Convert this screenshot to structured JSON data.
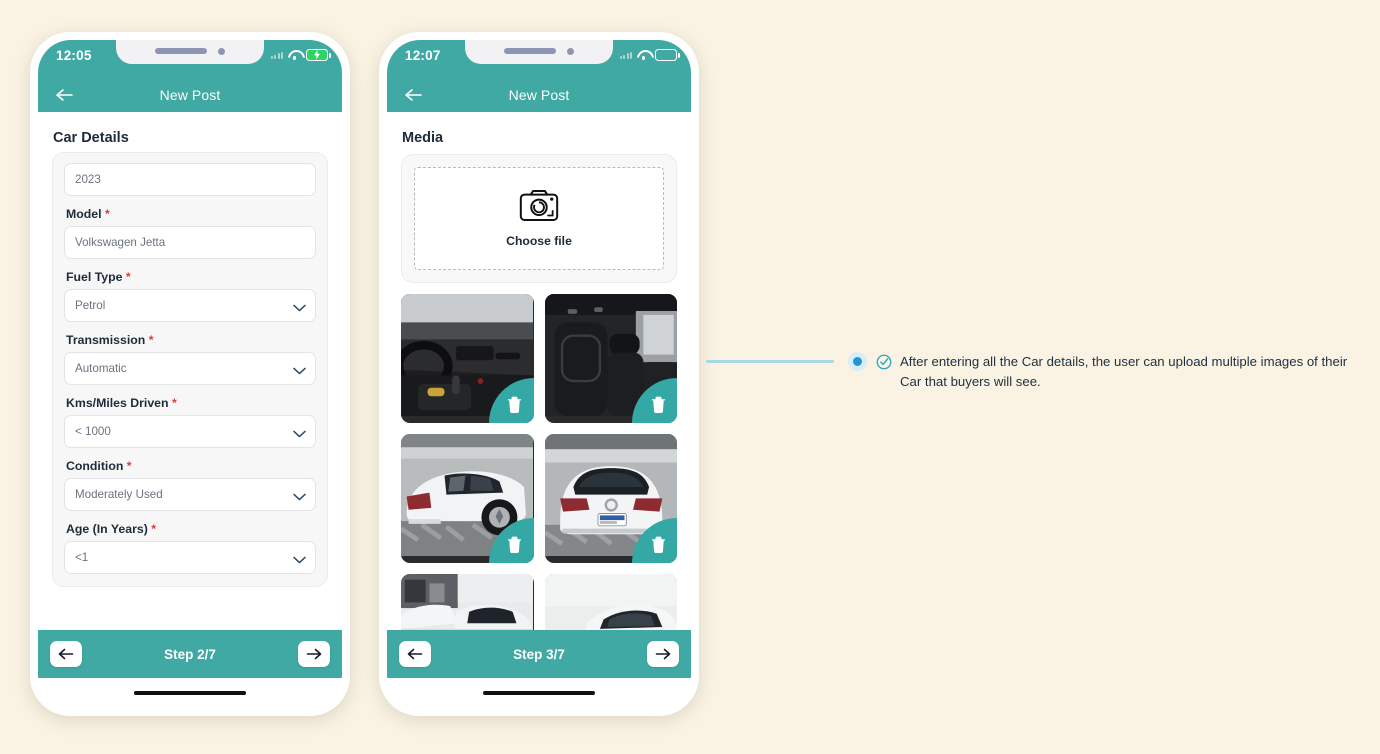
{
  "background_color": "#faf3e3",
  "accent_color": "#41a9a3",
  "required_color": "#e03b3b",
  "phones": [
    {
      "id": "phone-car-details",
      "status_bar": {
        "time": "12:05",
        "battery_state": "charging",
        "wifi_icon": "wifi-icon",
        "signal_icon": "signal-icon",
        "battery_icon": "battery-charging-icon"
      },
      "app_bar": {
        "title": "New Post",
        "back_icon": "back-arrow-icon"
      },
      "section_title": "Car Details",
      "fields": [
        {
          "label": "",
          "required": false,
          "value": "2023",
          "type": "text",
          "name": "year-field"
        },
        {
          "label": "Model",
          "required": true,
          "value": "Volkswagen Jetta",
          "type": "text",
          "name": "model-field"
        },
        {
          "label": "Fuel Type",
          "required": true,
          "value": "Petrol",
          "type": "select",
          "name": "fuel-type-select"
        },
        {
          "label": "Transmission",
          "required": true,
          "value": "Automatic",
          "type": "select",
          "name": "transmission-select"
        },
        {
          "label": "Kms/Miles Driven",
          "required": true,
          "value": "< 1000",
          "type": "select",
          "name": "kms-driven-select"
        },
        {
          "label": "Condition",
          "required": true,
          "value": "Moderately Used",
          "type": "select",
          "name": "condition-select"
        },
        {
          "label": "Age (In Years)",
          "required": true,
          "value": "<1",
          "type": "select",
          "name": "age-select"
        }
      ],
      "step_bar": {
        "label": "Step 2/7",
        "prev_icon": "arrow-left-icon",
        "next_icon": "arrow-right-icon"
      }
    },
    {
      "id": "phone-media",
      "status_bar": {
        "time": "12:07",
        "battery_state": "normal",
        "wifi_icon": "wifi-icon",
        "signal_icon": "signal-icon",
        "battery_icon": "battery-icon"
      },
      "app_bar": {
        "title": "New Post",
        "back_icon": "back-arrow-icon"
      },
      "section_title": "Media",
      "upload": {
        "label": "Choose file",
        "icon": "camera-icon"
      },
      "thumbnails": [
        {
          "name": "car-interior-dashboard",
          "delete_icon": "trash-icon"
        },
        {
          "name": "car-interior-seats",
          "delete_icon": "trash-icon"
        },
        {
          "name": "car-exterior-rear-side",
          "delete_icon": "trash-icon"
        },
        {
          "name": "car-exterior-rear",
          "delete_icon": "trash-icon"
        },
        {
          "name": "car-exterior-partial-left",
          "delete_icon": "trash-icon"
        },
        {
          "name": "car-exterior-partial-right",
          "delete_icon": "trash-icon"
        }
      ],
      "step_bar": {
        "label": "Step 3/7",
        "prev_icon": "arrow-left-icon",
        "next_icon": "arrow-right-icon"
      }
    }
  ],
  "annotation": {
    "icon": "check-circle-icon",
    "marker_icon": "connector-dot",
    "text": "After entering all the Car details, the user can upload multiple images of their Car that buyers will see."
  }
}
